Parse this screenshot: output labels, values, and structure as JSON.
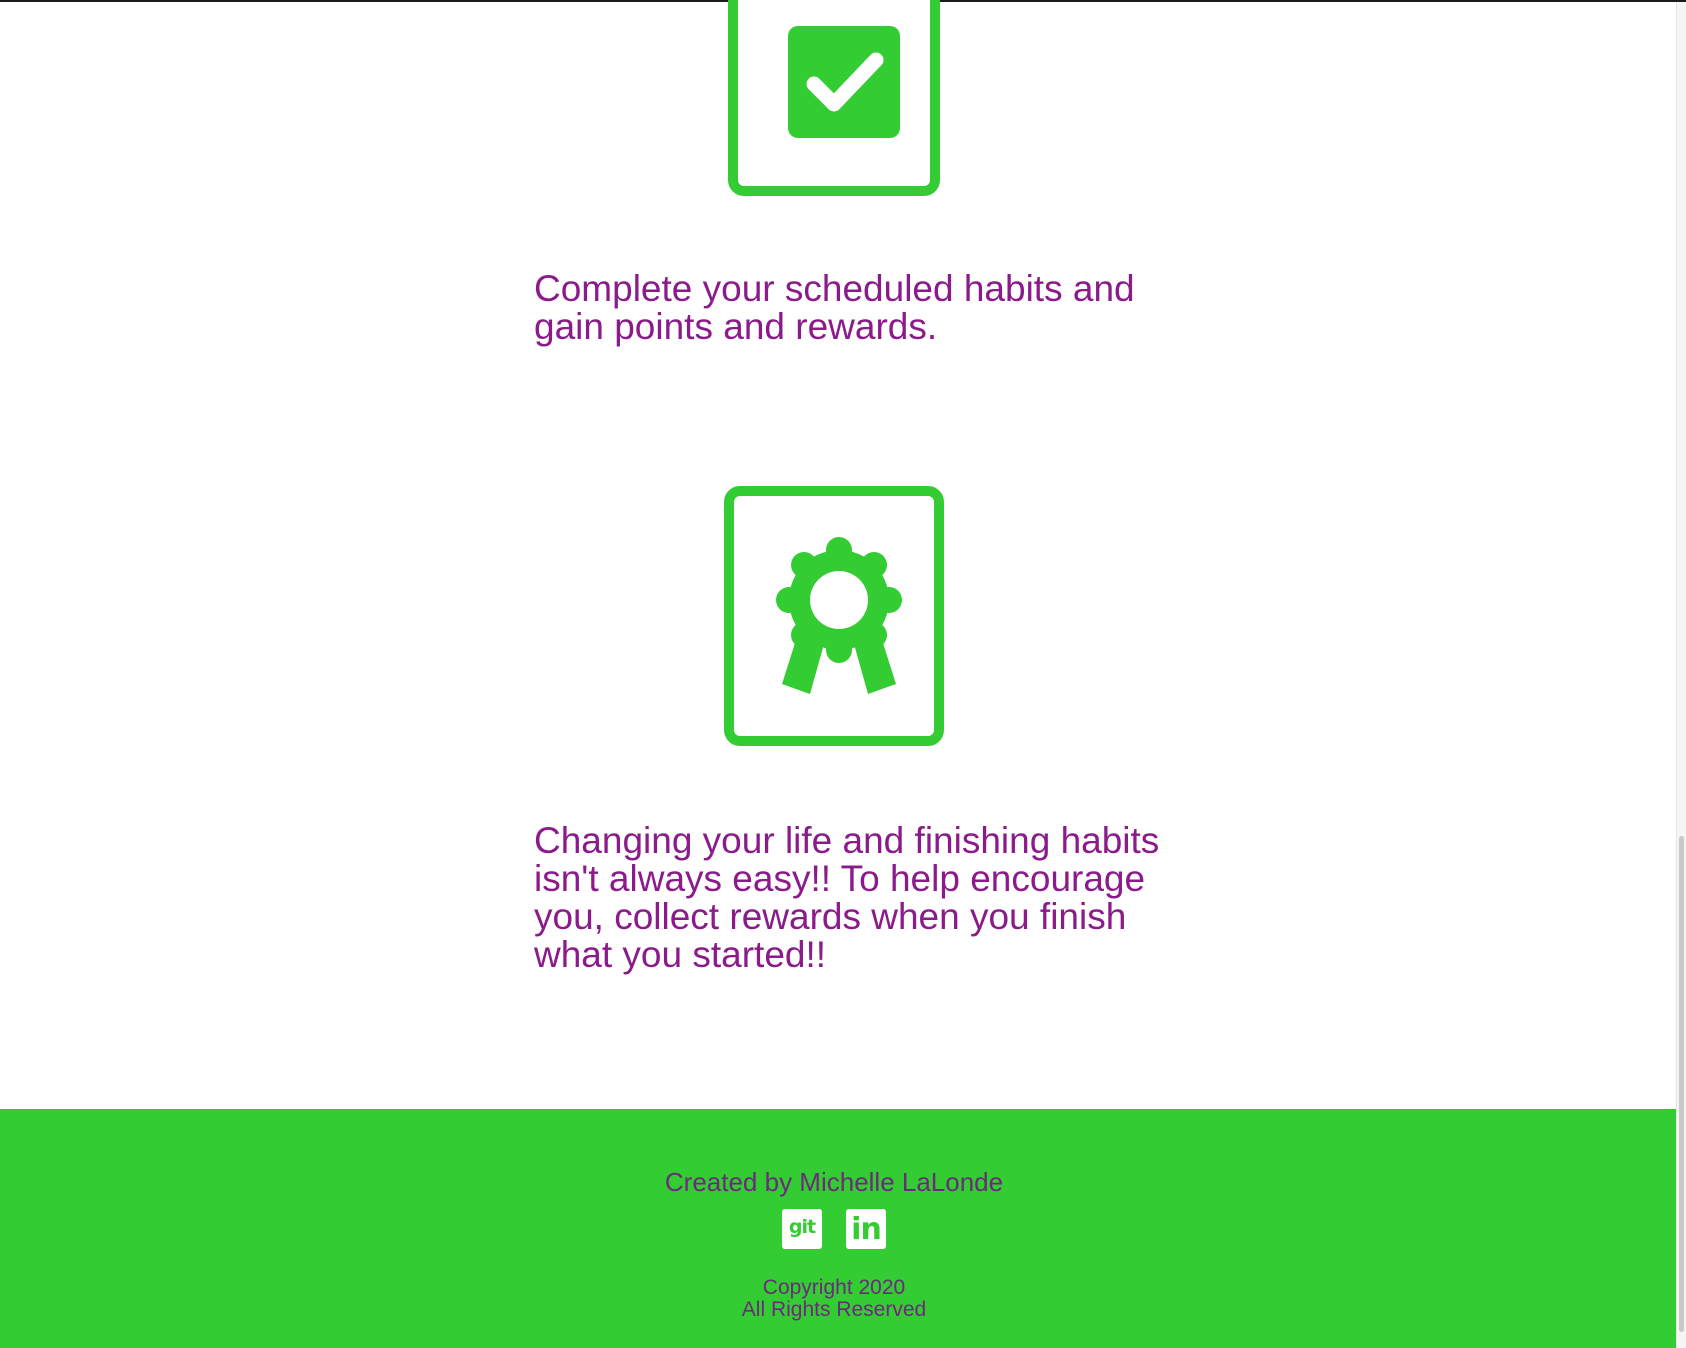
{
  "features": [
    {
      "icon": "checkbox-checked-icon",
      "text": "Complete your scheduled habits and gain points and rewards."
    },
    {
      "icon": "award-ribbon-icon",
      "text": "Changing your life and finishing habits isn't always easy!! To help encourage you, collect rewards when you finish what you started!!"
    }
  ],
  "footer": {
    "credit": "Created by Michelle LaLonde",
    "social": [
      {
        "label": "git",
        "icon": "git-icon"
      },
      {
        "label": "in",
        "icon": "linkedin-icon"
      }
    ],
    "copyright_line1": "Copyright 2020",
    "copyright_line2": "All Rights Reserved"
  },
  "colors": {
    "accent_green": "#34cc33",
    "text_purple": "#8b1a8b",
    "footer_text": "#6b2a7a",
    "background": "#ffffff"
  }
}
